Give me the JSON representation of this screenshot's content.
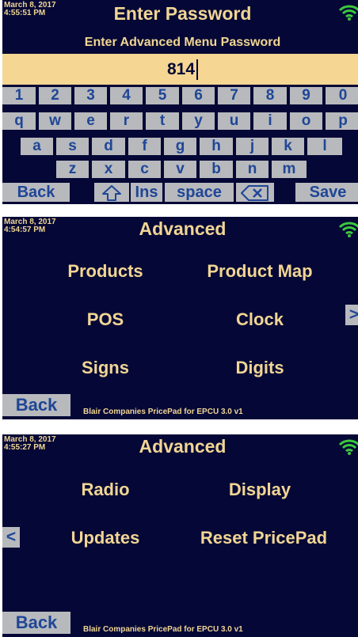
{
  "panel1": {
    "date": "March 8, 2017",
    "time": "4:55:51 PM",
    "title": "Enter Password",
    "subtitle": "Enter Advanced Menu Password",
    "password_value": "814",
    "keyboard": {
      "row1": [
        "1",
        "2",
        "3",
        "4",
        "5",
        "6",
        "7",
        "8",
        "9",
        "0"
      ],
      "row2": [
        "q",
        "w",
        "e",
        "r",
        "t",
        "y",
        "u",
        "i",
        "o",
        "p"
      ],
      "row3": [
        "a",
        "s",
        "d",
        "f",
        "g",
        "h",
        "j",
        "k",
        "l"
      ],
      "row4": [
        "z",
        "x",
        "c",
        "v",
        "b",
        "n",
        "m"
      ],
      "back_label": "Back",
      "ins_label": "Ins",
      "space_label": "space",
      "save_label": "Save"
    }
  },
  "panel2": {
    "date": "March 8, 2017",
    "time": "4:54:57 PM",
    "title": "Advanced",
    "menu": [
      "Products",
      "Product Map",
      "POS",
      "Clock",
      "Signs",
      "Digits"
    ],
    "next_label": ">",
    "back_label": "Back",
    "footer": "Blair Companies PricePad for EPCU 3.0 v1"
  },
  "panel3": {
    "date": "March 8, 2017",
    "time": "4:55:27 PM",
    "title": "Advanced",
    "menu": [
      "Radio",
      "Display",
      "Updates",
      "Reset PricePad"
    ],
    "prev_label": "<",
    "back_label": "Back",
    "footer": "Blair Companies PricePad for EPCU 3.0 v1"
  },
  "colors": {
    "background": "#050836",
    "text_gold": "#f1d594",
    "key_gray": "#b7b9bd",
    "key_text": "#1f4696",
    "input_bar": "#f5d693",
    "wifi": "#3cc83c"
  },
  "icons": {
    "wifi": "wifi-icon",
    "shift": "shift-arrow-icon",
    "backspace": "backspace-icon"
  }
}
